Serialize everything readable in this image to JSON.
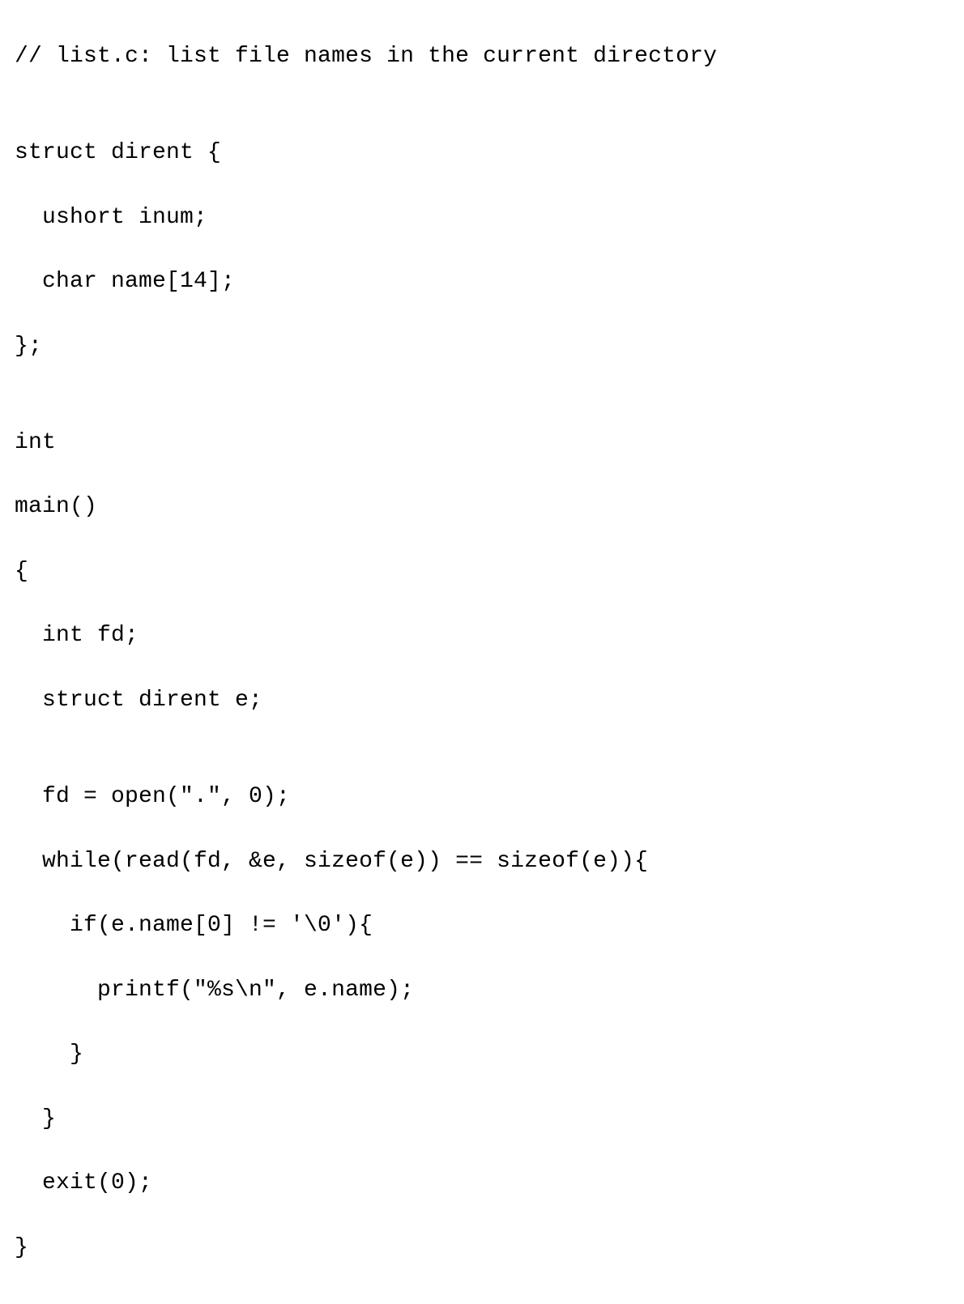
{
  "code": {
    "lines": [
      "// list.c: list file names in the current directory",
      "",
      "struct dirent {",
      "  ushort inum;",
      "  char name[14];",
      "};",
      "",
      "int",
      "main()",
      "{",
      "  int fd;",
      "  struct dirent e;",
      "",
      "  fd = open(\".\", 0);",
      "  while(read(fd, &e, sizeof(e)) == sizeof(e)){",
      "    if(e.name[0] != '\\0'){",
      "      printf(\"%s\\n\", e.name);",
      "    }",
      "  }",
      "  exit(0);",
      "}"
    ]
  }
}
